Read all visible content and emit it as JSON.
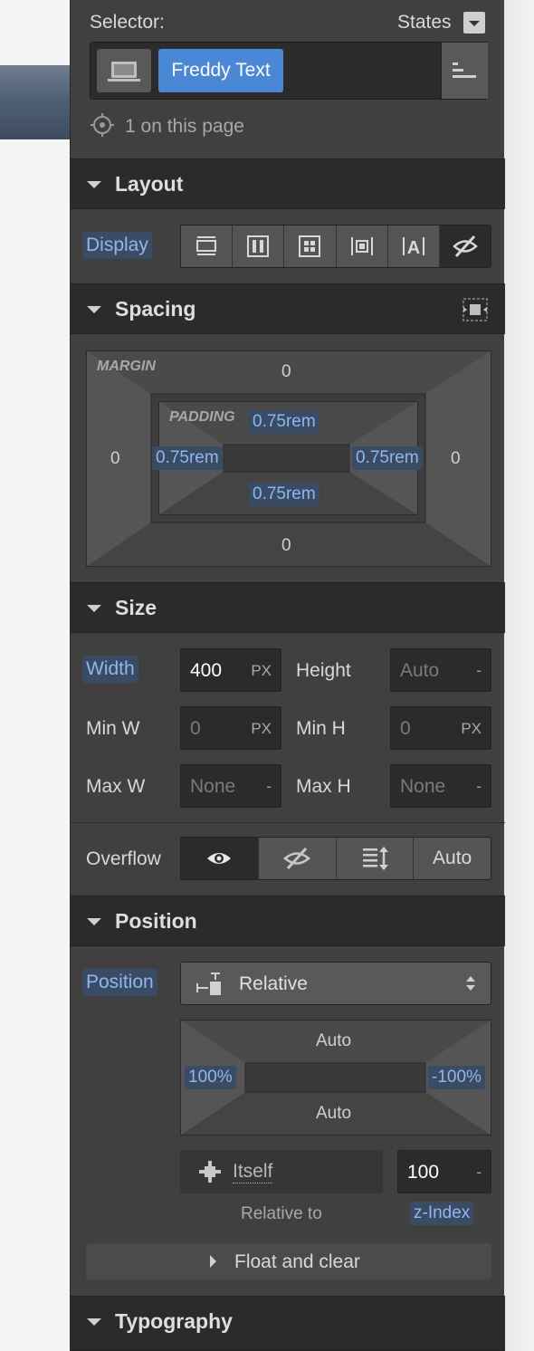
{
  "selector": {
    "label": "Selector:",
    "states_label": "States",
    "class_chip": "Freddy Text",
    "count_text": "1 on this page"
  },
  "layout": {
    "title": "Layout",
    "display_label": "Display",
    "display_options": [
      "block-icon",
      "flex-icon",
      "grid-icon",
      "inline-block-icon",
      "inline-icon",
      "none-icon"
    ],
    "active_display": "none"
  },
  "spacing": {
    "title": "Spacing",
    "margin_label": "MARGIN",
    "padding_label": "PADDING",
    "margin": {
      "top": "0",
      "right": "0",
      "bottom": "0",
      "left": "0"
    },
    "padding": {
      "top": "0.75rem",
      "right": "0.75rem",
      "bottom": "0.75rem",
      "left": "0.75rem"
    }
  },
  "size": {
    "title": "Size",
    "width_label": "Width",
    "width_value": "400",
    "width_unit": "PX",
    "height_label": "Height",
    "height_value": "Auto",
    "height_unit": "-",
    "minw_label": "Min W",
    "minw_value": "0",
    "minw_unit": "PX",
    "minh_label": "Min H",
    "minh_value": "0",
    "minh_unit": "PX",
    "maxw_label": "Max W",
    "maxw_value": "None",
    "maxw_unit": "-",
    "maxh_label": "Max H",
    "maxh_value": "None",
    "maxh_unit": "-",
    "overflow_label": "Overflow",
    "overflow_auto": "Auto"
  },
  "position": {
    "title": "Position",
    "position_label": "Position",
    "position_value": "Relative",
    "offset": {
      "top": "Auto",
      "right": "-100%",
      "bottom": "Auto",
      "left": "100%"
    },
    "relative_to_value": "Itself",
    "relative_to_label": "Relative to",
    "zindex_value": "100",
    "zindex_unit": "-",
    "zindex_label": "z-Index",
    "float_label": "Float and clear"
  },
  "typography": {
    "title": "Typography"
  }
}
